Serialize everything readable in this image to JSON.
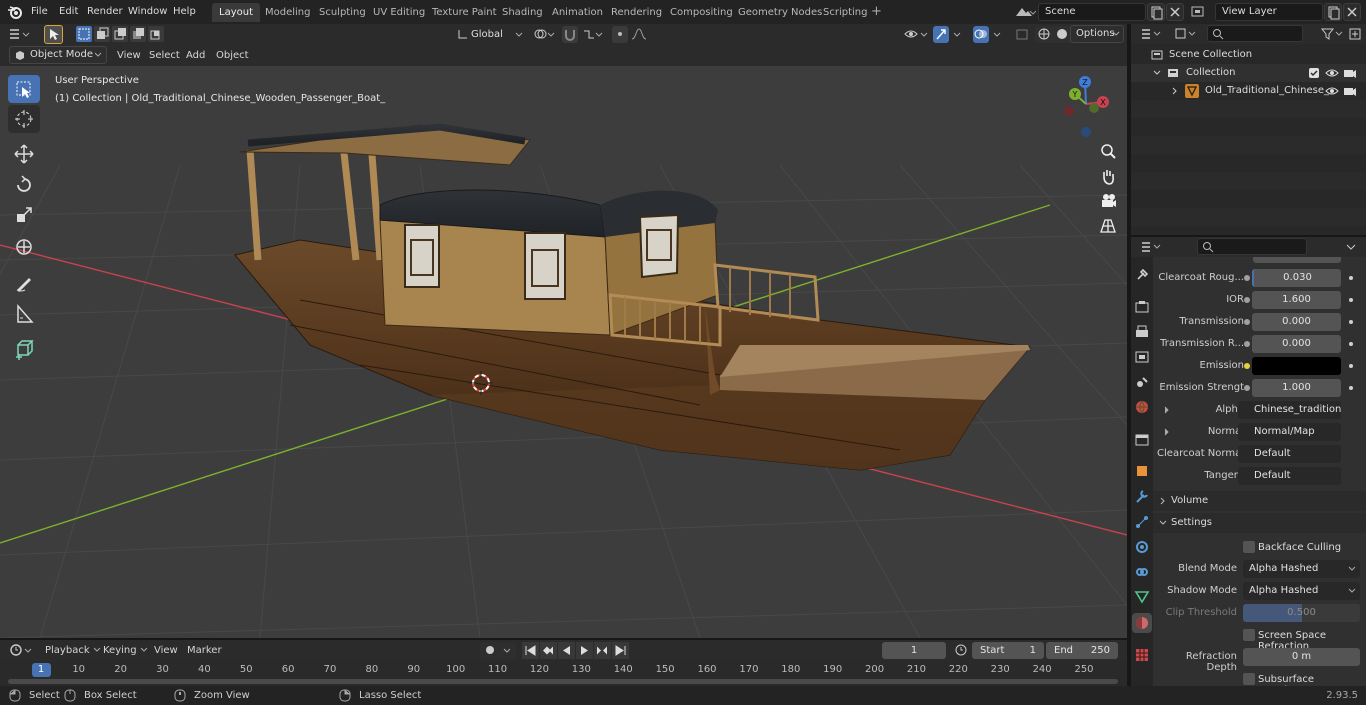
{
  "menu": {
    "file": "File",
    "edit": "Edit",
    "render": "Render",
    "window": "Window",
    "help": "Help"
  },
  "workspaces": [
    "Layout",
    "Modeling",
    "Sculpting",
    "UV Editing",
    "Texture Paint",
    "Shading",
    "Animation",
    "Rendering",
    "Compositing",
    "Geometry Nodes",
    "Scripting"
  ],
  "scene": {
    "name": "Scene",
    "view_layer": "View Layer"
  },
  "viewport_header": {
    "mode": "Object Mode",
    "view": "View",
    "select": "Select",
    "add": "Add",
    "object": "Object",
    "orientation": "Global",
    "options": "Options"
  },
  "viewport": {
    "perspective": "User Perspective",
    "collection_line": "(1) Collection | Old_Traditional_Chinese_Wooden_Passenger_Boat_"
  },
  "outliner": {
    "scene_collection": "Scene Collection",
    "collection": "Collection",
    "object": "Old_Traditional_Chinese_"
  },
  "properties": {
    "rows": [
      {
        "label": "Clearcoat Roug...",
        "value": "0.030",
        "kind": "num"
      },
      {
        "label": "IOR",
        "value": "1.600",
        "kind": "num"
      },
      {
        "label": "Transmission",
        "value": "0.000",
        "kind": "num"
      },
      {
        "label": "Transmission R...",
        "value": "0.000",
        "kind": "num"
      },
      {
        "label": "Emission",
        "value": "",
        "kind": "color"
      },
      {
        "label": "Emission Strengt",
        "value": "1.000",
        "kind": "num"
      },
      {
        "label": "Alpha",
        "value": "Chinese_traditional_...",
        "kind": "link"
      },
      {
        "label": "Normal",
        "value": "Normal/Map",
        "kind": "link"
      },
      {
        "label": "Clearcoat Normal",
        "value": "Default",
        "kind": "link"
      },
      {
        "label": "Tangent",
        "value": "Default",
        "kind": "link"
      }
    ],
    "volume": "Volume",
    "settings": "Settings",
    "backface_culling": "Backface Culling",
    "blend_mode_label": "Blend Mode",
    "blend_mode": "Alpha Hashed",
    "shadow_mode_label": "Shadow Mode",
    "shadow_mode": "Alpha Hashed",
    "clip_threshold_label": "Clip Threshold",
    "clip_threshold": "0.500",
    "screen_space_refraction": "Screen Space Refraction",
    "refraction_depth_label": "Refraction Depth",
    "refraction_depth": "0 m",
    "subsurface_translucency": "Subsurface Translucency"
  },
  "timeline": {
    "playback": "Playback",
    "keying": "Keying",
    "view": "View",
    "marker": "Marker",
    "current_frame": "1",
    "start_label": "Start",
    "start": "1",
    "end_label": "End",
    "end": "250",
    "ticks": [
      "1",
      "10",
      "20",
      "30",
      "40",
      "50",
      "60",
      "70",
      "80",
      "90",
      "100",
      "110",
      "120",
      "130",
      "140",
      "150",
      "160",
      "170",
      "180",
      "190",
      "200",
      "210",
      "220",
      "230",
      "240",
      "250"
    ]
  },
  "statusbar": {
    "select": "Select",
    "box_select": "Box Select",
    "zoom_view": "Zoom View",
    "lasso_select": "Lasso Select",
    "version": "2.93.5"
  },
  "colors": {
    "accent": "#4772b3",
    "x_axis": "#c9424f",
    "y_axis": "#7db02e",
    "z_axis": "#3e7ed8",
    "emission": "#000000"
  }
}
